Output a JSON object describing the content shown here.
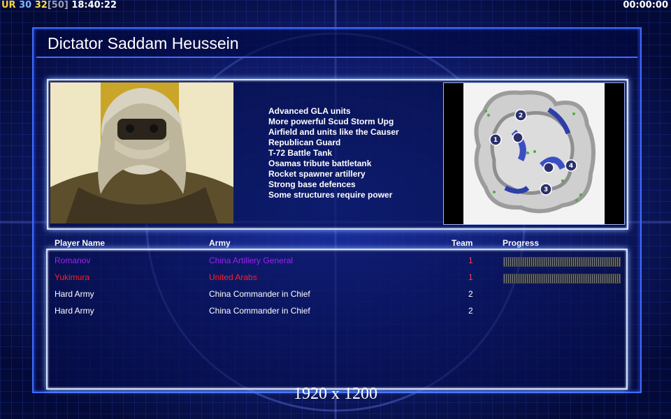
{
  "hud": {
    "ur_label": "UR",
    "fps": "30",
    "fps_current": "32",
    "fps_limit": "[50]",
    "clock": "18:40:22",
    "timer": "00:00:00"
  },
  "title": "Dictator Saddam Heussein",
  "description": [
    "Advanced GLA units",
    "More powerful Scud Storm Upg",
    "Airfield and units like the Causer",
    "Republican Guard",
    "T-72 Battle Tank",
    "Osamas tribute battletank",
    "Rocket spawner artillery",
    "Strong base defences",
    "Some structures require power"
  ],
  "minimap": {
    "icon": "minimap-terrain",
    "start_positions": [
      "1",
      "2",
      "3",
      "4"
    ]
  },
  "table": {
    "headers": {
      "player": "Player Name",
      "army": "Army",
      "team": "Team",
      "progress": "Progress"
    },
    "rows": [
      {
        "name": "Romanov",
        "army": "China Artillery General",
        "team": "1",
        "color": "#a020f0",
        "team_color": "#ff3b3b",
        "progress": true
      },
      {
        "name": "Yukimura",
        "army": "United Arabs",
        "team": "1",
        "color": "#ff2020",
        "team_color": "#ff3b3b",
        "progress": true
      },
      {
        "name": "Hard Army",
        "army": "China Commander in Chief",
        "team": "2",
        "color": "#ffffff",
        "team_color": "#ffffff",
        "progress": false
      },
      {
        "name": "Hard Army",
        "army": "China Commander in Chief",
        "team": "2",
        "color": "#ffffff",
        "team_color": "#ffffff",
        "progress": false
      }
    ]
  },
  "resolution": "1920 x 1200",
  "colors": {
    "accent": "#3f6cff",
    "background": "#06104a"
  }
}
